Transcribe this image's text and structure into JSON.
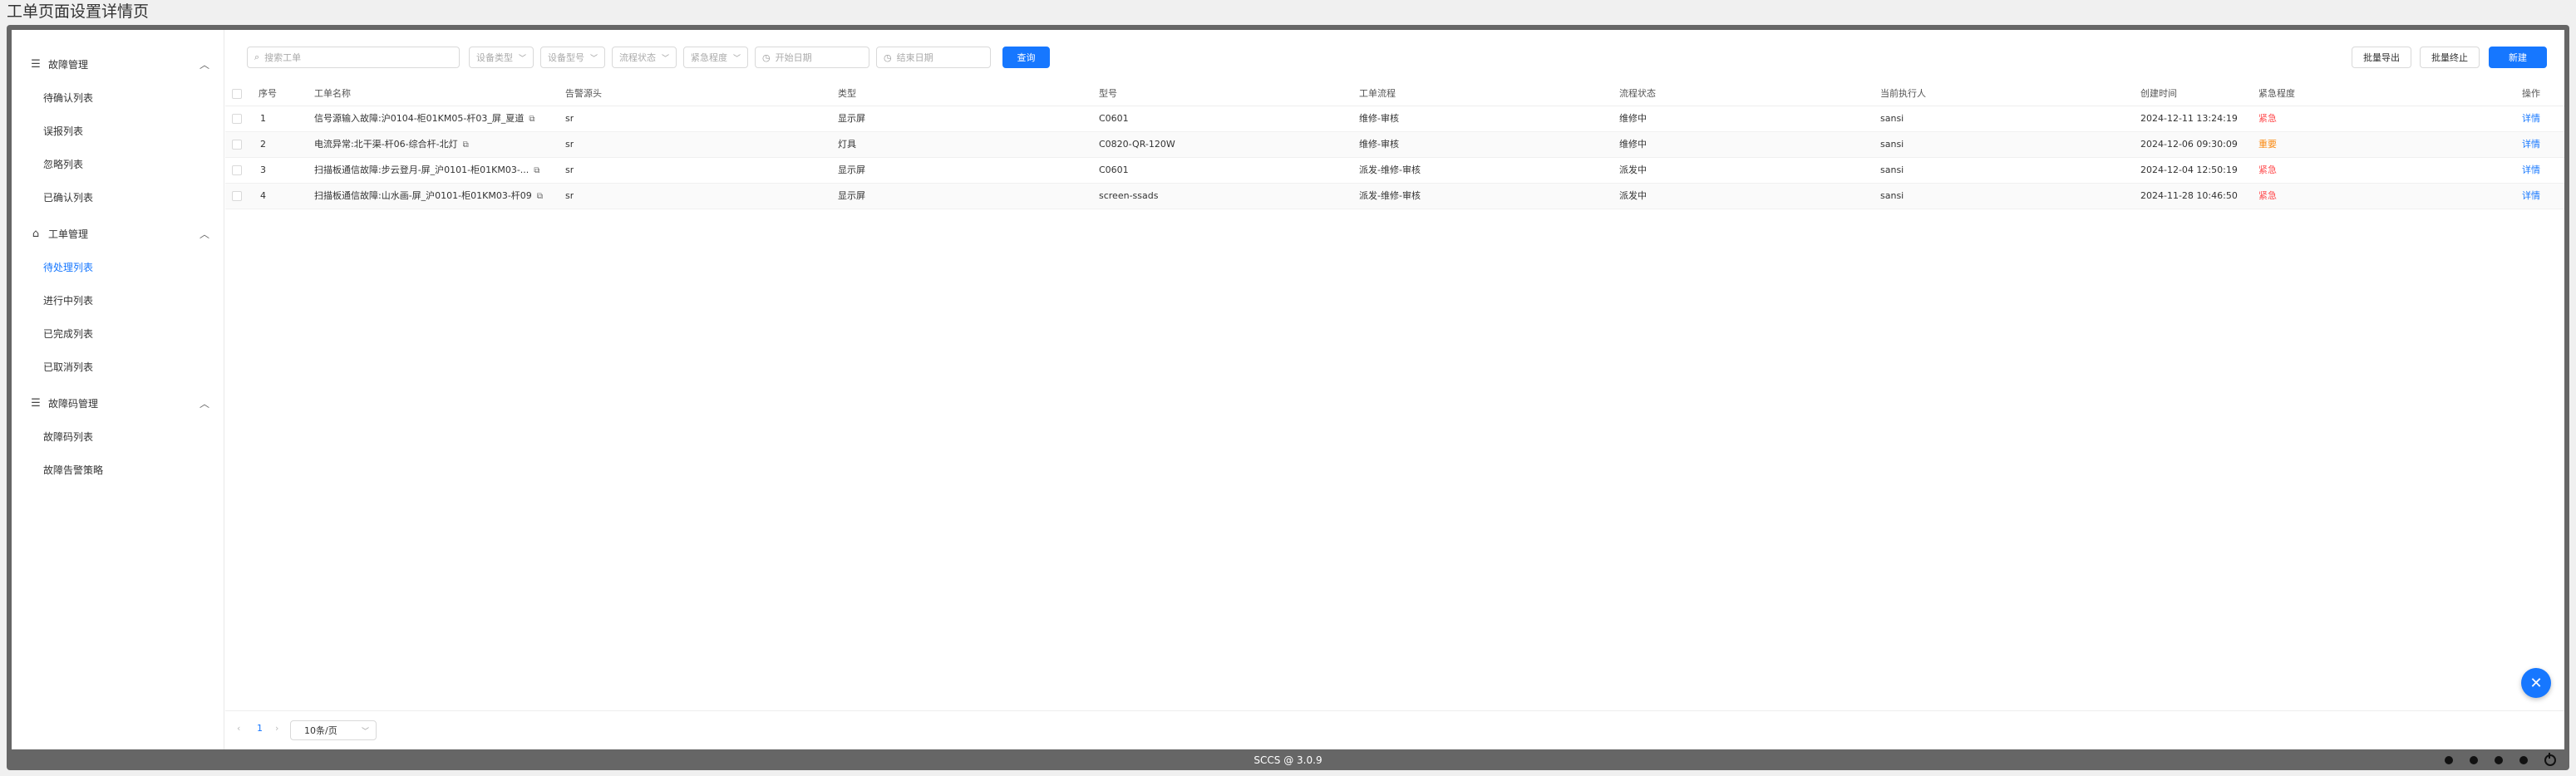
{
  "page_title": "工单页面设置详情页",
  "sidebar": {
    "groups": [
      {
        "label": "故障管理",
        "icon": "list-icon",
        "items": [
          "待确认列表",
          "误报列表",
          "忽略列表",
          "已确认列表"
        ]
      },
      {
        "label": "工单管理",
        "icon": "work-order-icon",
        "items": [
          "待处理列表",
          "进行中列表",
          "已完成列表",
          "已取消列表"
        ]
      },
      {
        "label": "故障码管理",
        "icon": "list-icon",
        "items": [
          "故障码列表",
          "故障告警策略"
        ]
      }
    ],
    "active_item": "待处理列表"
  },
  "toolbar": {
    "search_placeholder": "搜索工单",
    "device_type": "设备类型",
    "device_model": "设备型号",
    "flow_status": "流程状态",
    "urgency": "紧急程度",
    "start_date": "开始日期",
    "end_date": "结束日期",
    "query_label": "查询",
    "batch_export": "批量导出",
    "batch_stop": "批量终止",
    "new_label": "新建"
  },
  "table": {
    "columns": [
      "序号",
      "工单名称",
      "告警源头",
      "类型",
      "型号",
      "工单流程",
      "流程状态",
      "当前执行人",
      "创建时间",
      "紧急程度",
      "操作"
    ],
    "rows": [
      {
        "no": "1",
        "name": "信号源输入故障:沪0104-柜01KM05-杆03_屏_夏道",
        "source": "sr",
        "type": "显示屏",
        "model": "C0601",
        "flow": "维修-审核",
        "status": "维修中",
        "executor": "sansi",
        "created": "2024-12-11 13:24:19",
        "urgency": "紧急",
        "urgency_color": "#ff4d4f",
        "action": "详情"
      },
      {
        "no": "2",
        "name": "电流异常:北干渠-杆06-综合杆-北灯",
        "source": "sr",
        "type": "灯具",
        "model": "C0820-QR-120W",
        "flow": "维修-审核",
        "status": "维修中",
        "executor": "sansi",
        "created": "2024-12-06 09:30:09",
        "urgency": "重要",
        "urgency_color": "#fa8c16",
        "action": "详情"
      },
      {
        "no": "3",
        "name": "扫描板通信故障:步云登月-屏_沪0101-柜01KM03-...",
        "source": "sr",
        "type": "显示屏",
        "model": "C0601",
        "flow": "派发-维修-审核",
        "status": "派发中",
        "executor": "sansi",
        "created": "2024-12-04 12:50:19",
        "urgency": "紧急",
        "urgency_color": "#ff4d4f",
        "action": "详情"
      },
      {
        "no": "4",
        "name": "扫描板通信故障:山水画-屏_沪0101-柜01KM03-杆09",
        "source": "sr",
        "type": "显示屏",
        "model": "screen-ssads",
        "flow": "派发-维修-审核",
        "status": "派发中",
        "executor": "sansi",
        "created": "2024-11-28 10:46:50",
        "urgency": "紧急",
        "urgency_color": "#ff4d4f",
        "action": "详情"
      }
    ]
  },
  "pagination": {
    "current_page": "1",
    "page_size": "10条/页"
  },
  "footer": {
    "version": "SCCS @ 3.0.9"
  },
  "colors": {
    "accent": "#1677ff",
    "urgent": "#ff4d4f",
    "important": "#fa8c16"
  }
}
